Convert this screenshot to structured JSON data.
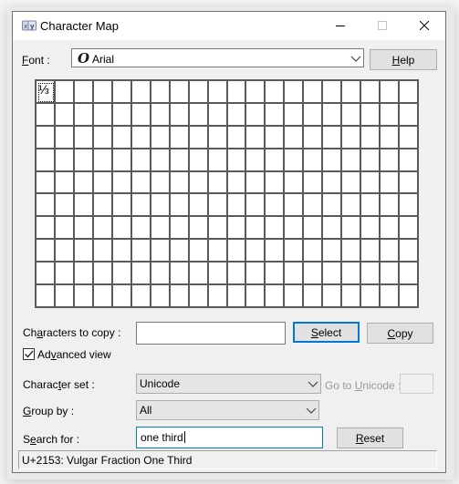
{
  "window": {
    "title": "Character Map",
    "app_icon": "charmap-icon",
    "controls": {
      "minimize": "minimize-icon",
      "maximize": "maximize-icon",
      "close": "close-icon"
    }
  },
  "font": {
    "label_prefix": "",
    "label_accel": "F",
    "label_rest": "ont :",
    "value": "Arial",
    "font_type_icon": "opentype-font-icon"
  },
  "help_button": {
    "accel": "H",
    "rest": "elp"
  },
  "grid": {
    "columns": 20,
    "rows": 10,
    "selected_glyph": "⅓",
    "cells": [
      "⅓"
    ]
  },
  "characters_to_copy": {
    "label_pre": "Ch",
    "label_accel": "a",
    "label_rest": "racters to copy :",
    "value": ""
  },
  "select_button": {
    "accel": "S",
    "rest": "elect"
  },
  "copy_button": {
    "accel": "C",
    "rest": "opy"
  },
  "advanced_view": {
    "checked": true,
    "label_pre": "Ad",
    "label_accel": "v",
    "label_rest": "anced view"
  },
  "character_set": {
    "label_pre": "Charac",
    "label_accel": "t",
    "label_rest": "er set :",
    "value": "Unicode"
  },
  "go_to_unicode": {
    "label_pre": "Go to ",
    "label_accel": "U",
    "label_rest": "nicode :",
    "value": ""
  },
  "group_by": {
    "label_accel": "G",
    "label_rest": "roup by :",
    "value": "All"
  },
  "search_for": {
    "label_pre": "S",
    "label_accel": "e",
    "label_rest": "arch for :",
    "value": "one third"
  },
  "reset_button": {
    "accel": "R",
    "rest": "eset"
  },
  "status": {
    "text": "U+2153: Vulgar Fraction One Third"
  },
  "colors": {
    "accent": "#0078d7",
    "grid_line": "#5a5a5a",
    "button_face": "#e1e1e1"
  }
}
